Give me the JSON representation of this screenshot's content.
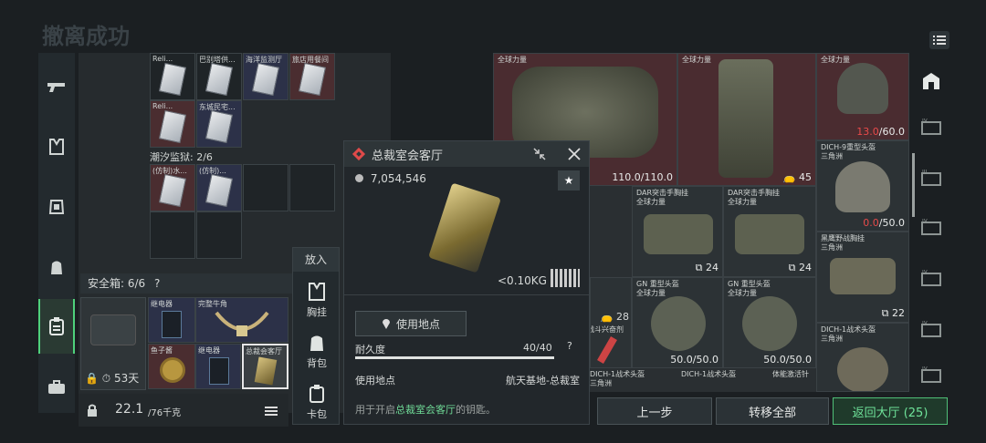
{
  "page_title": "撤离成功",
  "left_grid": {
    "row1": [
      "Reli...",
      "巴别塔供...",
      "海洋监测厅",
      "旅店用餐间"
    ],
    "row2": [
      "Reli...",
      "东城民宅..."
    ],
    "section2_label": "潮汐监狱: 2/6",
    "row3": [
      "(仿制)水...",
      "(仿制)..."
    ]
  },
  "safe_box": {
    "label": "安全箱: 6/6",
    "help": "?",
    "timer": "53天",
    "items": [
      {
        "name": "继电器"
      },
      {
        "name": "完整牛角"
      },
      {
        "name": "鱼子酱"
      },
      {
        "name": "继电器"
      },
      {
        "name": "总裁会客厅"
      }
    ]
  },
  "weight": {
    "current": "22.1",
    "max": "/76千克"
  },
  "put_in": {
    "title": "放入",
    "options": [
      "胸挂",
      "背包",
      "卡包"
    ]
  },
  "popup": {
    "title": "总裁室会客厅",
    "price": "7,054,546",
    "weight": "<0.10KG",
    "location_button": "使用地点",
    "durability_label": "耐久度",
    "durability_value": "40/40",
    "durability_fraction": 1.0,
    "location_label": "使用地点",
    "location_value": "航天基地-总裁室",
    "desc_prefix": "用于开启",
    "desc_highlight": "总裁室会客厅",
    "desc_suffix": "的钥匙。"
  },
  "right_items": {
    "armor": {
      "name": "全球力量",
      "value": "110.0/110.0"
    },
    "backpack": {
      "name": "全球力量",
      "count": "45"
    },
    "helmet1": {
      "name": "全球力量",
      "value_red": "13.0",
      "value_max": "/60.0"
    },
    "helmet2": {
      "name": "DICH-9重型头盔\n三角洲",
      "value_red": "0.0",
      "value_max": "/50.0"
    },
    "rig1": {
      "name": "DAR突击手胸挂\n全球力量",
      "count": "24"
    },
    "rig2": {
      "name": "DAR突击手胸挂\n全球力量",
      "count": "24"
    },
    "rig3": {
      "name": "黑鹰野战胸挂\n三角洲",
      "count": "22"
    },
    "left_small": {
      "count": "28",
      "name": "战斗兴奋剂"
    },
    "helmet3": {
      "name": "GN 重型头盔\n全球力量",
      "value": "50.0/50.0"
    },
    "helmet4": {
      "name": "GN 重型头盔\n全球力量",
      "value": "50.0/50.0"
    },
    "helmet5": {
      "name": "DICH-1战术头盔\n三角洲"
    },
    "bottom_labels": [
      "DICH-1战术头盔",
      "DICH-1战术头盔",
      "体能激活针"
    ],
    "bottom_sub": "三角洲"
  },
  "buttons": {
    "back": "上一步",
    "transfer_all": "转移全部",
    "return_lobby": "返回大厅 (25)"
  }
}
